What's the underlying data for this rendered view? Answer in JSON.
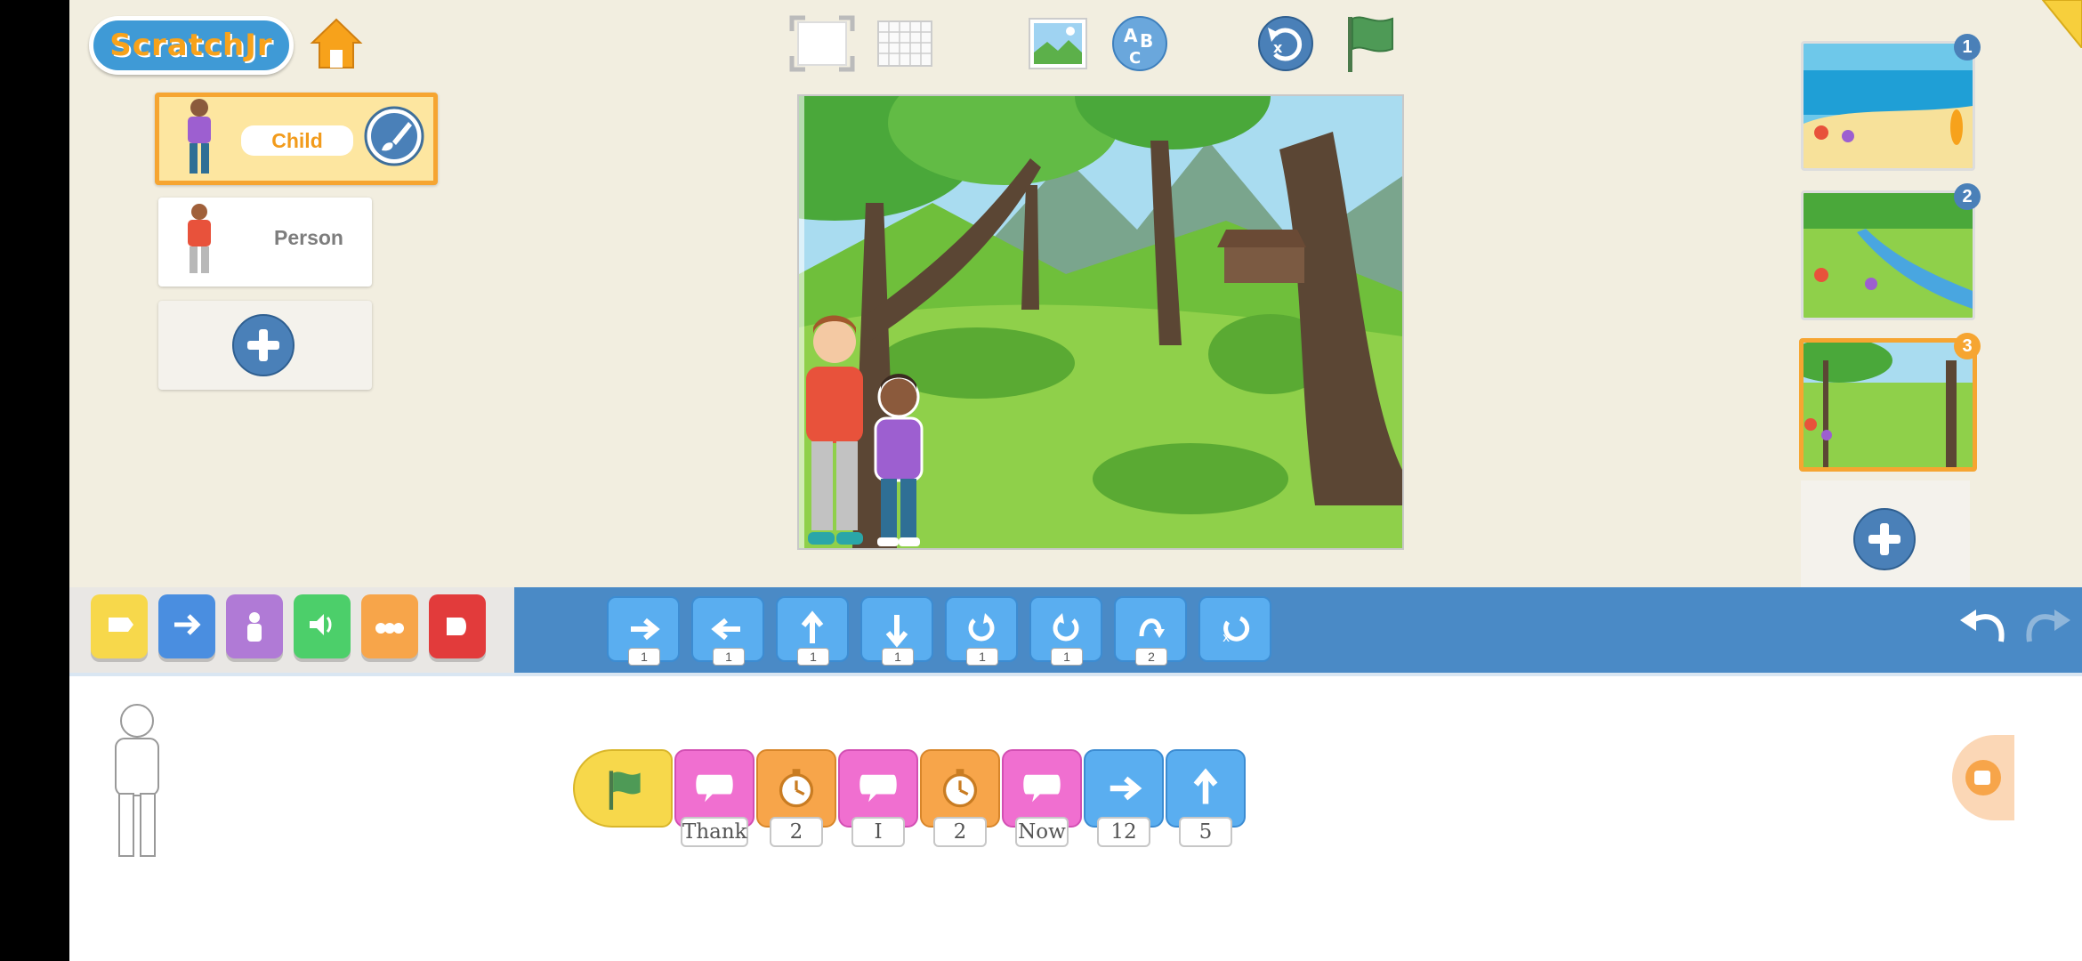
{
  "app": {
    "logo_text": "ScratchJr",
    "accent": "#f6a531",
    "palette_blue": "#4a8ac6"
  },
  "header": {
    "icons": [
      "home-icon",
      "full-screen-icon",
      "grid-icon",
      "background-icon",
      "text-icon",
      "reset-icon",
      "green-flag-icon"
    ]
  },
  "sprites": [
    {
      "name": "Child",
      "selected": true
    },
    {
      "name": "Person",
      "selected": false
    }
  ],
  "pages": [
    {
      "number": "1",
      "scene": "beach"
    },
    {
      "number": "2",
      "scene": "river"
    },
    {
      "number": "3",
      "scene": "forest",
      "selected": true
    }
  ],
  "categories": [
    {
      "name": "triggering",
      "color": "#f7d84b"
    },
    {
      "name": "motion",
      "color": "#4a8ee0"
    },
    {
      "name": "looks",
      "color": "#b07ad6"
    },
    {
      "name": "sound",
      "color": "#4ccf6a"
    },
    {
      "name": "control",
      "color": "#f7a54a"
    },
    {
      "name": "end",
      "color": "#e23b3b"
    }
  ],
  "motion_blocks": [
    {
      "icon": "move-right-icon",
      "value": "1"
    },
    {
      "icon": "move-left-icon",
      "value": "1"
    },
    {
      "icon": "move-up-icon",
      "value": "1"
    },
    {
      "icon": "move-down-icon",
      "value": "1"
    },
    {
      "icon": "turn-right-icon",
      "value": "1"
    },
    {
      "icon": "turn-left-icon",
      "value": "1"
    },
    {
      "icon": "hop-icon",
      "value": "2"
    },
    {
      "icon": "go-home-icon",
      "value": ""
    }
  ],
  "script": [
    {
      "type": "green-flag-start",
      "value": ""
    },
    {
      "type": "say",
      "value": "Thank"
    },
    {
      "type": "wait",
      "value": "2"
    },
    {
      "type": "say",
      "value": "I"
    },
    {
      "type": "wait",
      "value": "2"
    },
    {
      "type": "say",
      "value": "Now"
    },
    {
      "type": "move-right",
      "value": "12"
    },
    {
      "type": "move-up",
      "value": "5"
    }
  ]
}
